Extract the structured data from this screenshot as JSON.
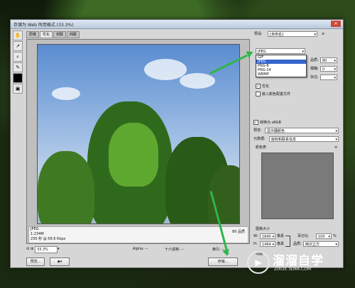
{
  "window": {
    "title": "存储为 Web 所用格式 (33.3%)"
  },
  "tabs": [
    "原稿",
    "优化",
    "双联",
    "四联"
  ],
  "preview_info": {
    "format": "JPEG",
    "size": "1.234M",
    "time": "230 秒 @ 56.6 Kbps",
    "quality": "80 品质"
  },
  "statusbar": {
    "zoom": "33.3%",
    "alpha": "Alpha: --",
    "hex": "十六进制: --",
    "index": "索引: --"
  },
  "bottom": {
    "preview_label": "预览...",
    "save_label": "存储..."
  },
  "panel": {
    "preset_label": "预设:",
    "preset_value": "[未命名]",
    "format_value": "JPEG",
    "format_options": [
      "GIF",
      "JPEG",
      "PNG-8",
      "PNG-24",
      "WBMP"
    ],
    "quality_label": "品质:",
    "quality_value": "80",
    "blur_label": "模糊:",
    "blur_value": "0",
    "matte_label": "杂边:",
    "progressive_label": "优化",
    "embed_profile_label": "嵌入颜色配置文件",
    "convert_srgb_label": "转换为 sRGB",
    "preview_label": "预览:",
    "preview_value": "显示器颜色",
    "metadata_label": "元数据:",
    "metadata_value": "版权和联系信息",
    "color_table_label": "颜色表",
    "image_size_label": "图像大小",
    "width_label": "W:",
    "width_value": "1840",
    "height_label": "H:",
    "height_value": "1464",
    "px_unit": "像素",
    "percent_label": "百分比:",
    "percent_value": "100",
    "percent_unit": "%",
    "resample_label": "品质:",
    "resample_value": "两次立方",
    "animation_label": "动画"
  },
  "watermark": {
    "title": "溜溜自学",
    "sub": "ZIXUE.3D66.COM"
  },
  "colors": {
    "arrow": "#2fb54a",
    "highlight": "#3366cc"
  }
}
